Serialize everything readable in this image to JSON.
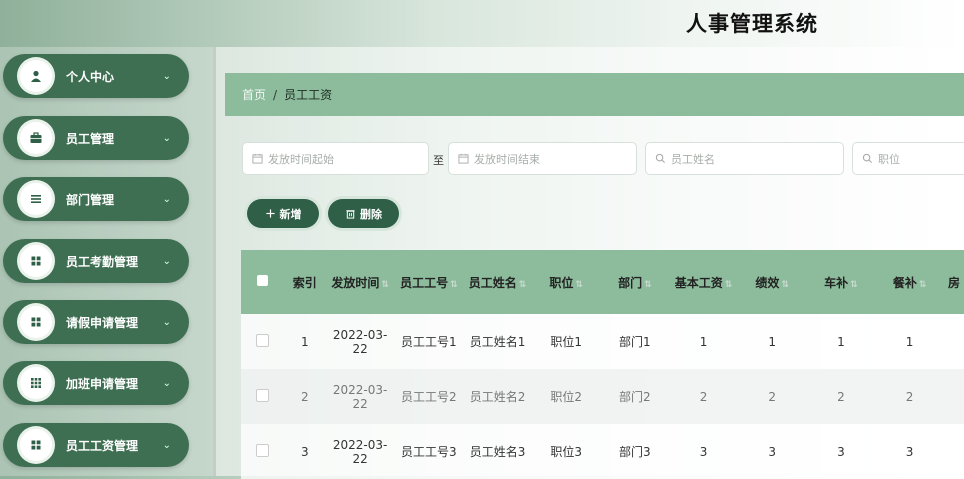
{
  "app": {
    "title": "人事管理系统"
  },
  "sidebar": {
    "items": [
      {
        "label": "个人中心",
        "icon": "user-icon"
      },
      {
        "label": "员工管理",
        "icon": "briefcase-icon"
      },
      {
        "label": "部门管理",
        "icon": "list-icon"
      },
      {
        "label": "员工考勤管理",
        "icon": "grid-icon"
      },
      {
        "label": "请假申请管理",
        "icon": "grid-icon"
      },
      {
        "label": "加班申请管理",
        "icon": "grid-9-icon"
      },
      {
        "label": "员工工资管理",
        "icon": "grid-icon"
      }
    ]
  },
  "breadcrumb": {
    "home": "首页",
    "separator": "/",
    "current": "员工工资"
  },
  "filters": {
    "date_start_placeholder": "发放时间起始",
    "to_label": "至",
    "date_end_placeholder": "发放时间结束",
    "name_placeholder": "员工姓名",
    "position_placeholder": "职位"
  },
  "toolbar": {
    "add_label": "新增",
    "delete_label": "删除"
  },
  "table": {
    "headers": [
      "索引",
      "发放时间",
      "员工工号",
      "员工姓名",
      "职位",
      "部门",
      "基本工资",
      "绩效",
      "车补",
      "餐补",
      "房"
    ],
    "rows": [
      {
        "index": "1",
        "date": "2022-03-22",
        "emp_no": "员工工号1",
        "emp_name": "员工姓名1",
        "position": "职位1",
        "dept": "部门1",
        "base": "1",
        "perf": "1",
        "car": "1",
        "meal": "1"
      },
      {
        "index": "2",
        "date": "2022-03-22",
        "emp_no": "员工工号2",
        "emp_name": "员工姓名2",
        "position": "职位2",
        "dept": "部门2",
        "base": "2",
        "perf": "2",
        "car": "2",
        "meal": "2"
      },
      {
        "index": "3",
        "date": "2022-03-22",
        "emp_no": "员工工号3",
        "emp_name": "员工姓名3",
        "position": "职位3",
        "dept": "部门3",
        "base": "3",
        "perf": "3",
        "car": "3",
        "meal": "3"
      }
    ]
  },
  "colors": {
    "accent": "#3f6f52",
    "header_bg": "#8cbc9c",
    "button": "#2f5f46"
  }
}
